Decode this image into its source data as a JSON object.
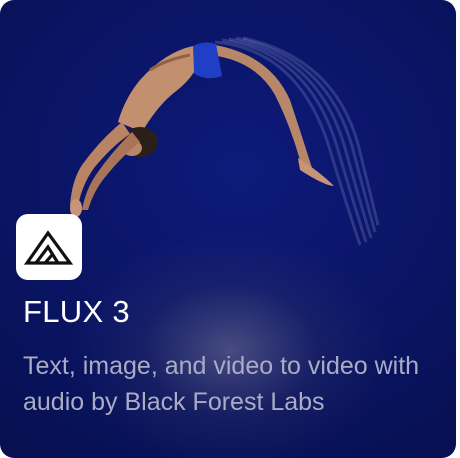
{
  "card": {
    "title": "FLUX 3",
    "description": "Text, image, and video to video with audio by Black Forest Labs",
    "logo": "black-forest-labs-logo",
    "image": "diver-mid-air-photo"
  }
}
